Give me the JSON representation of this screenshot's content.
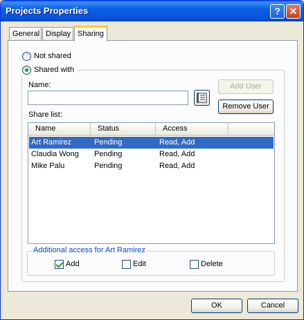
{
  "window": {
    "title": "Projects Properties",
    "help_glyph": "?",
    "close_glyph": "✕"
  },
  "tabs": [
    {
      "label": "General",
      "active": false
    },
    {
      "label": "Display",
      "active": false
    },
    {
      "label": "Sharing",
      "active": true
    }
  ],
  "sharing": {
    "not_shared_label": "Not shared",
    "shared_with_label": "Shared with",
    "selected_option": "shared_with",
    "name_label": "Name:",
    "name_value": "",
    "add_user_label": "Add User",
    "add_user_enabled": false,
    "remove_user_label": "Remove User",
    "share_list_label": "Share list:",
    "columns": [
      "Name",
      "Status",
      "Access"
    ],
    "rows": [
      {
        "name": "Art Ramirez",
        "status": "Pending",
        "access": "Read, Add",
        "selected": true
      },
      {
        "name": "Claudia Wong",
        "status": "Pending",
        "access": "Read, Add",
        "selected": false
      },
      {
        "name": "Mike Palu",
        "status": "Pending",
        "access": "Read, Add",
        "selected": false
      }
    ],
    "additional_access_label": "Additional access for Art Ramirez",
    "options": [
      {
        "label": "Add",
        "checked": true
      },
      {
        "label": "Edit",
        "checked": false
      },
      {
        "label": "Delete",
        "checked": false
      }
    ]
  },
  "footer": {
    "ok_label": "OK",
    "cancel_label": "Cancel"
  },
  "colors": {
    "title_bar": "#0a5ee8",
    "selection": "#316ac5",
    "tab_highlight": "#ffc83c"
  }
}
